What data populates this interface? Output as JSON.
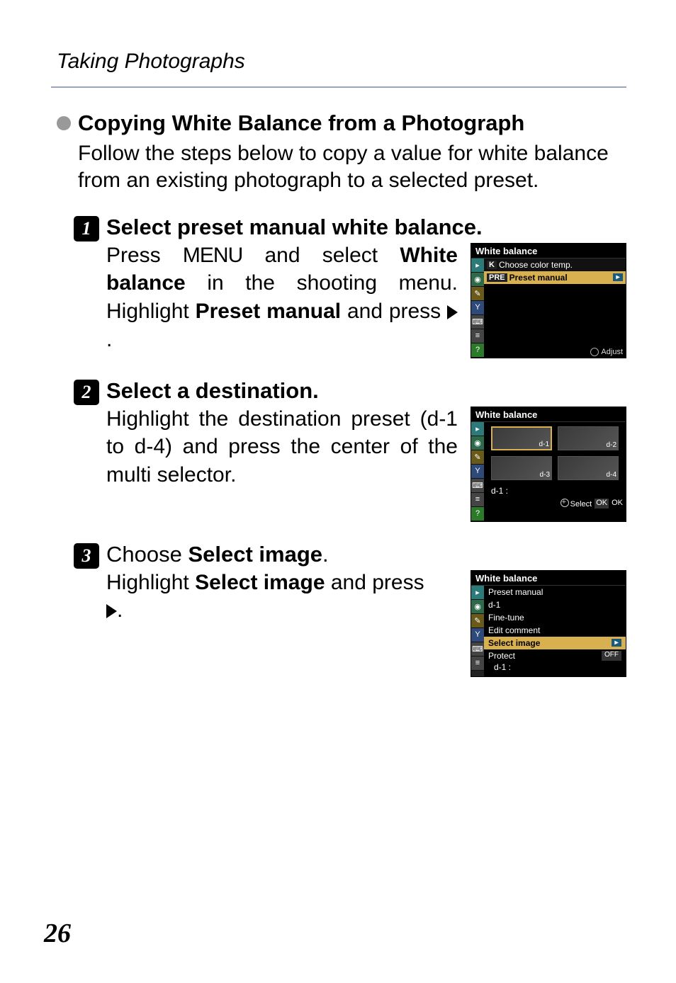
{
  "header": "Taking Photographs",
  "section": {
    "title": "Copying White Balance from a Photograph",
    "desc": "Follow the steps below to copy a value for white balance from an existing photograph to a selected preset."
  },
  "steps": [
    {
      "num": "1",
      "title": "Select preset manual white balance.",
      "text_prefix": "Press ",
      "menu_word": "MENU",
      "text_mid1": " and select ",
      "bold1": "White balance",
      "text_mid2": " in the shooting menu. Highlight ",
      "bold2": "Preset manual",
      "text_mid3": " and press ",
      "text_suffix": "."
    },
    {
      "num": "2",
      "title": "Select a destination.",
      "text": "Highlight the destination preset (d-1 to d-4) and press the center of the multi selector."
    },
    {
      "num": "3",
      "title_prefix": "Choose ",
      "title_bold": "Select image",
      "title_suffix": ".",
      "text_prefix": "Highlight ",
      "bold": "Select image",
      "text_mid": " and press ",
      "text_suffix": "."
    }
  ],
  "screenshots": {
    "s1": {
      "title": "White balance",
      "row1_prefix": "K",
      "row1": "Choose color temp.",
      "row2_prefix": "PRE",
      "row2": "Preset manual",
      "footer": "Adjust"
    },
    "s2": {
      "title": "White balance",
      "cells": [
        "d-1",
        "d-2",
        "d-3",
        "d-4"
      ],
      "label": "d-1 :",
      "footer_select": "Select",
      "footer_ok": "OK"
    },
    "s3": {
      "title": "White balance",
      "rows": [
        "Preset manual",
        "d-1",
        "Fine-tune",
        "Edit comment",
        "Select image",
        "Protect"
      ],
      "off": "OFF",
      "dlabel": "d-1 :"
    }
  },
  "page_number": "26"
}
